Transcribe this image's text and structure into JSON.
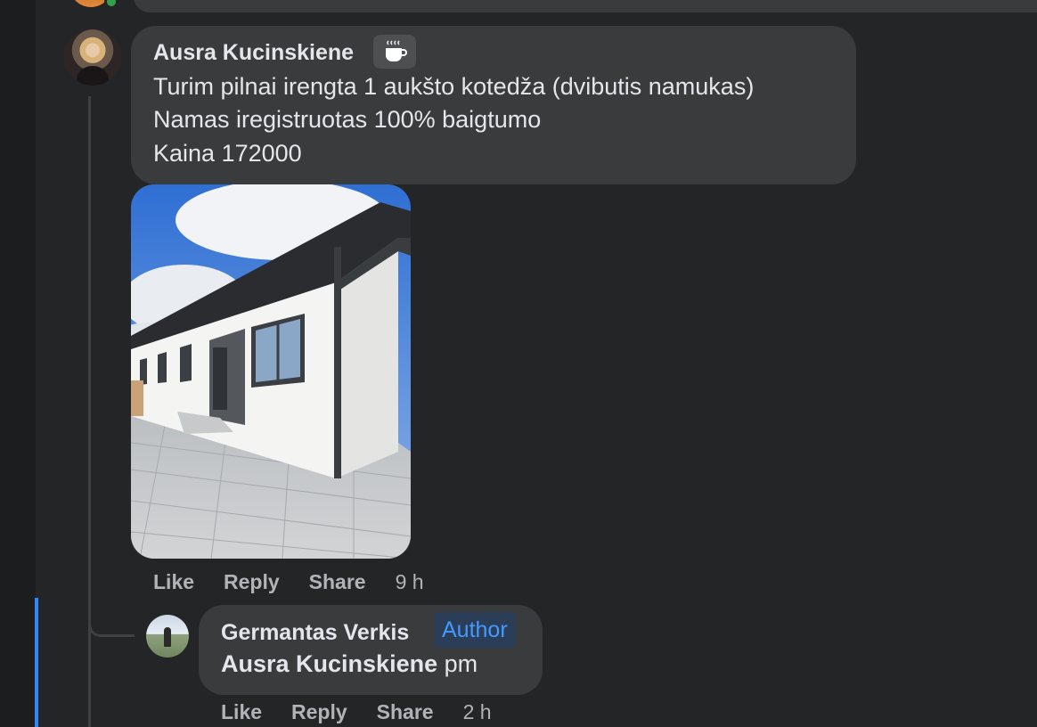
{
  "previous_comment": {
    "avatar_icon": "user-avatar-icon",
    "online_status_color": "#31a24c"
  },
  "main_comment": {
    "author": "Ausra Kucinskiene",
    "badge_icon": "coffee-cup-icon",
    "text_lines": [
      "Turim pilnai irengta 1 aukšto kotedža (dvibutis namukas)",
      "Namas iregistruotas 100% baigtumo",
      "Kaina 172000"
    ],
    "attachment": "house-photo",
    "actions": {
      "like": "Like",
      "reply": "Reply",
      "share": "Share",
      "time": "9 h"
    }
  },
  "reply_comment": {
    "author": "Germantas Verkis",
    "author_tag": "Author",
    "mention": "Ausra Kucinskiene",
    "text": "pm",
    "actions": {
      "like": "Like",
      "reply": "Reply",
      "share": "Share",
      "time": "2 h"
    }
  },
  "colors": {
    "background": "#242526",
    "bubble": "#3a3b3c",
    "accent": "#2d88ff",
    "author_tag_text": "#4599ff"
  }
}
